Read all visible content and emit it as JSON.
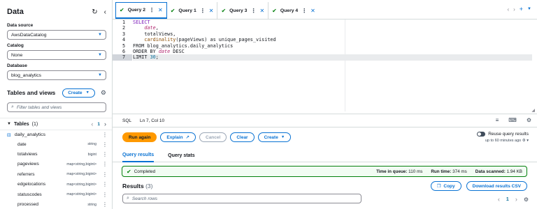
{
  "sidebar": {
    "title": "Data",
    "data_source_label": "Data source",
    "data_source_value": "AwsDataCatalog",
    "catalog_label": "Catalog",
    "catalog_value": "None",
    "database_label": "Database",
    "database_value": "blog_analytics",
    "tables_views_title": "Tables and views",
    "create_label": "Create",
    "filter_placeholder": "Filter tables and views",
    "tables_label": "Tables",
    "tables_count": "(1)",
    "page_num": "1",
    "table_name": "daily_analytics",
    "columns": [
      {
        "name": "date",
        "type": "string"
      },
      {
        "name": "totalviews",
        "type": "bigint"
      },
      {
        "name": "pageviews",
        "type": "map<string,bigint>"
      },
      {
        "name": "referrers",
        "type": "map<string,bigint>"
      },
      {
        "name": "edgelocations",
        "type": "map<string,bigint>"
      },
      {
        "name": "statuscodes",
        "type": "map<string,bigint>"
      },
      {
        "name": "processed",
        "type": "string"
      }
    ]
  },
  "tabs": [
    {
      "label": "Query 2"
    },
    {
      "label": "Query 1"
    },
    {
      "label": "Query 3"
    },
    {
      "label": "Query 4"
    }
  ],
  "editor": {
    "line_numbers": [
      "1",
      "2",
      "3",
      "4",
      "5",
      "6",
      "7"
    ],
    "lines": {
      "l1": "SELECT",
      "l2_field": "date",
      "l3": "    totalViews,",
      "l4_fn": "cardinality",
      "l4_rest": "(pageViews) as unique_pages_visited",
      "l5": "FROM blog_analytics.daily_analytics",
      "l6_kw": "ORDER BY ",
      "l6_field": "date",
      "l6_dir": " DESC",
      "l7_kw": "LIMIT ",
      "l7_num": "30",
      "l7_end": ";"
    }
  },
  "status": {
    "lang": "SQL",
    "position": "Ln 7, Col 10"
  },
  "actions": {
    "run_again": "Run again",
    "explain": "Explain",
    "cancel": "Cancel",
    "clear": "Clear",
    "create": "Create",
    "reuse_label": "Reuse query results",
    "reuse_sub": "up to 60 minutes ago"
  },
  "result_tabs": {
    "results": "Query results",
    "stats": "Query stats"
  },
  "completion": {
    "status": "Completed",
    "queue_label": "Time in queue:",
    "queue_value": "110 ms",
    "run_label": "Run time:",
    "run_value": "374 ms",
    "scanned_label": "Data scanned:",
    "scanned_value": "1.94 KB"
  },
  "results": {
    "title": "Results",
    "count": "(3)",
    "copy": "Copy",
    "download": "Download results CSV",
    "search_placeholder": "Search rows",
    "page_num": "1"
  },
  "colors": {
    "accent": "#0972d3",
    "primary_button": "#ff9900",
    "success": "#037f0c"
  }
}
